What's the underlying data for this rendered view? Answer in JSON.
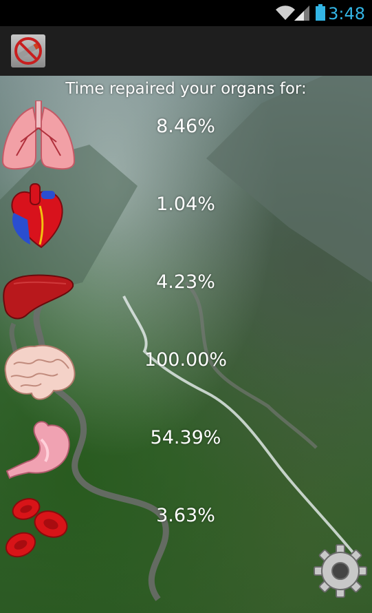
{
  "status_bar": {
    "time": "3:48",
    "icons": [
      "wifi-icon",
      "signal-icon",
      "battery-icon"
    ],
    "accent_color": "#33b5e5"
  },
  "action_bar": {
    "icon": "no-smoking-icon"
  },
  "main": {
    "heading": "Time repaired your organs for:",
    "organs": [
      {
        "icon": "lungs-icon",
        "value": "8.46%"
      },
      {
        "icon": "heart-icon",
        "value": "1.04%"
      },
      {
        "icon": "liver-icon",
        "value": "4.23%"
      },
      {
        "icon": "brain-icon",
        "value": "100.00%"
      },
      {
        "icon": "stomach-icon",
        "value": "54.39%"
      },
      {
        "icon": "blood-cells-icon",
        "value": "3.63%"
      }
    ],
    "settings_icon": "gear-icon"
  }
}
